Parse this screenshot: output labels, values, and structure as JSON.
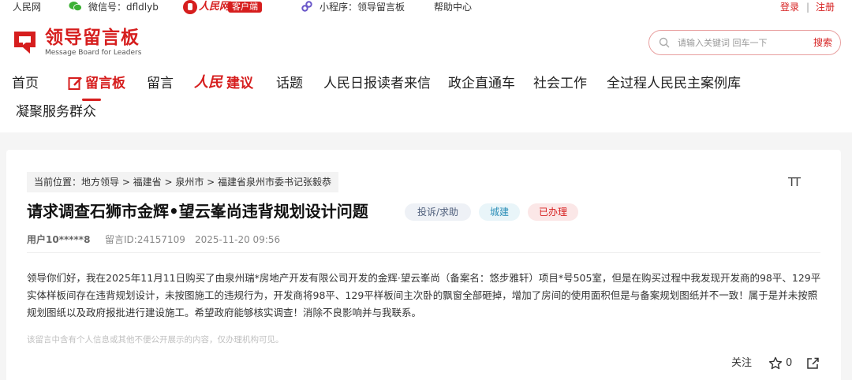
{
  "topbar": {
    "site": "人民网",
    "wechat": "微信号：dfldlyb",
    "rmw_logo": "人民网+",
    "client": "客户端",
    "miniprogram": "小程序：领导留言板",
    "help": "帮助中心",
    "login": "登录",
    "separator": "|",
    "register": "注册"
  },
  "header": {
    "logo_title": "领导留言板",
    "logo_subtitle": "Message Board for Leaders",
    "search_placeholder": "请输入关键词 回车一下",
    "search_button": "搜索"
  },
  "nav": {
    "home": "首页",
    "board": "留言板",
    "message": "留言",
    "rm_logo": "人民",
    "suggest": "建议",
    "topics": "话题",
    "readers": "人民日报读者来信",
    "enterprise": "政企直通车",
    "social": "社会工作",
    "democracy": "全过程人民民主案例库",
    "serve": "凝聚服务群众"
  },
  "post": {
    "breadcrumb": "当前位置：地方领导 > 福建省 > 泉州市 > 福建省泉州市委书记张毅恭",
    "font_toggle": "TT",
    "title": "请求调查石狮市金辉•望云峯尚违背规划设计问题",
    "tags": [
      "投诉/求助",
      "城建",
      "已办理"
    ],
    "user": "用户10*****8",
    "message_id": "留言ID:24157109",
    "time": "2025-11-20 09:56",
    "content": "领导你们好，我在2025年11月11日购买了由泉州瑞*房地产开发有限公司开发的金辉·望云峯尚（备案名：悠步雅轩）项目*号505室，但是在购买过程中我发现开发商的98平、129平实体样板间存在违背规划设计，未按图施工的违规行为，开发商将98平、129平样板间主次卧的飘窗全部砸掉，增加了房间的使用面积但是与备案规划图纸并不一致！属于是并未按照规划图纸以及政府报批进行建设施工。希望政府能够核实调查！消除不良影响并与我联系。",
    "privacy_note": "该留言中含有个人信息或其他不便公开展示的内容，仅办理机构可见。",
    "follow": "关注",
    "like_count": "0"
  },
  "colors": {
    "accent": "#d61e1e",
    "background": "#f5f5f5"
  }
}
